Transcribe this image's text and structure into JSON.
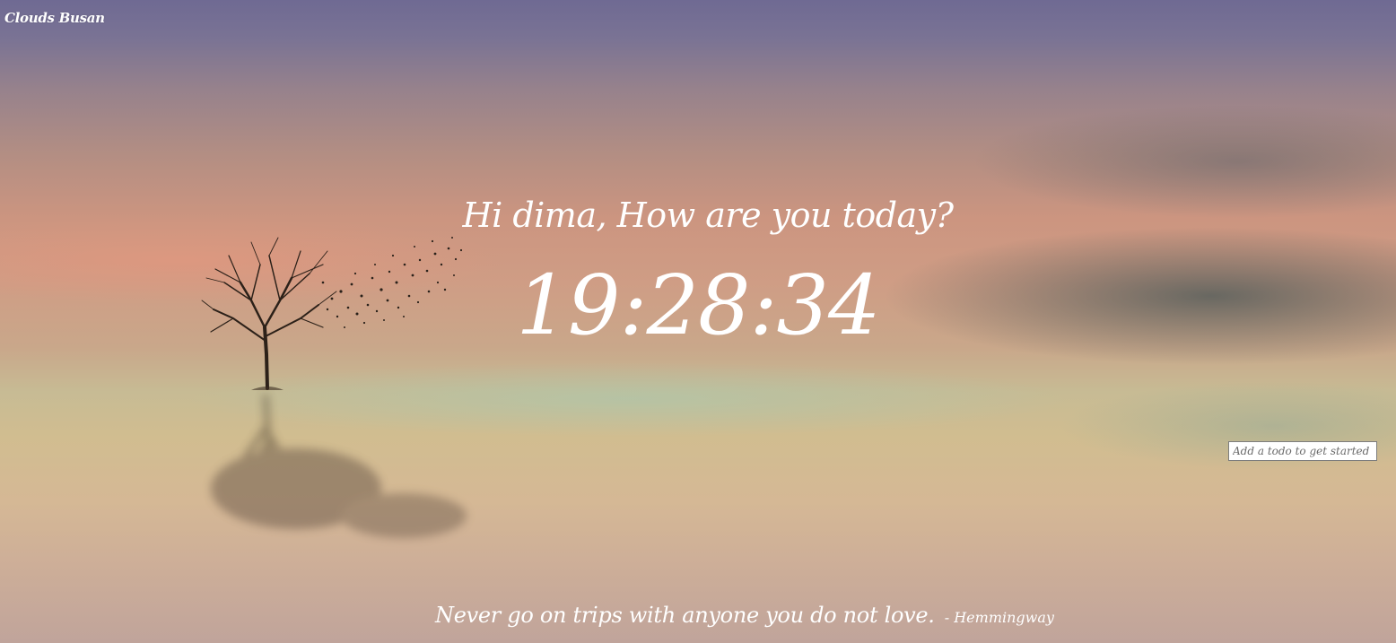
{
  "location": {
    "label": "Clouds Busan"
  },
  "greeting": {
    "text": "Hi dima, How are you today?"
  },
  "clock": {
    "time": "19:28:34"
  },
  "todo": {
    "placeholder": "Add a todo to get started"
  },
  "quote": {
    "text": "Never go on trips with anyone you do not love.",
    "author": "- Hemmingway"
  },
  "background": {
    "sky_top": "#6f6a93",
    "sky_mid": "#cc9580",
    "ground": "#d1bd90"
  }
}
